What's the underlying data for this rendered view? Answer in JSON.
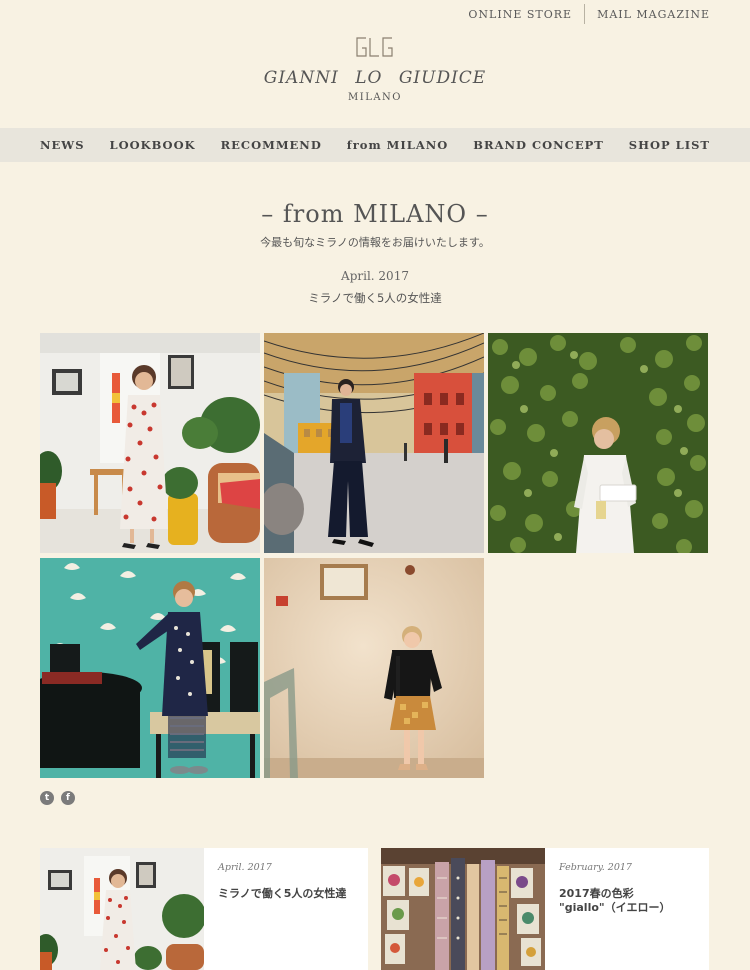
{
  "header": {
    "links": [
      "ONLINE STORE",
      "MAIL MAGAZINE"
    ],
    "logo": {
      "monogram": "GLG",
      "name": "GIANNI LO GIUDICE",
      "city": "MILANO"
    }
  },
  "nav": {
    "items": [
      "NEWS",
      "LOOKBOOK",
      "RECOMMEND",
      "from MILANO",
      "BRAND CONCEPT",
      "SHOP LIST"
    ]
  },
  "page": {
    "title": "– from MILANO –",
    "lead": "今最も旬なミラノの情報をお届けいたします。"
  },
  "post": {
    "date": "April. 2017",
    "title": "ミラノで働く5人の女性達",
    "photos": [
      "woman-in-white-room",
      "woman-in-courtyard",
      "woman-by-ivy-wall",
      "woman-by-teal-wall",
      "woman-by-plaster-wall"
    ]
  },
  "share": {
    "icons": [
      "twitter-icon",
      "facebook-icon"
    ],
    "glyphs": [
      "t",
      "f"
    ]
  },
  "related": [
    {
      "date": "April. 2017",
      "title": "ミラノで働く5人の女性達"
    },
    {
      "date": "February. 2017",
      "title": "2017春の色彩 \"giallo\"（イエロー）"
    }
  ]
}
